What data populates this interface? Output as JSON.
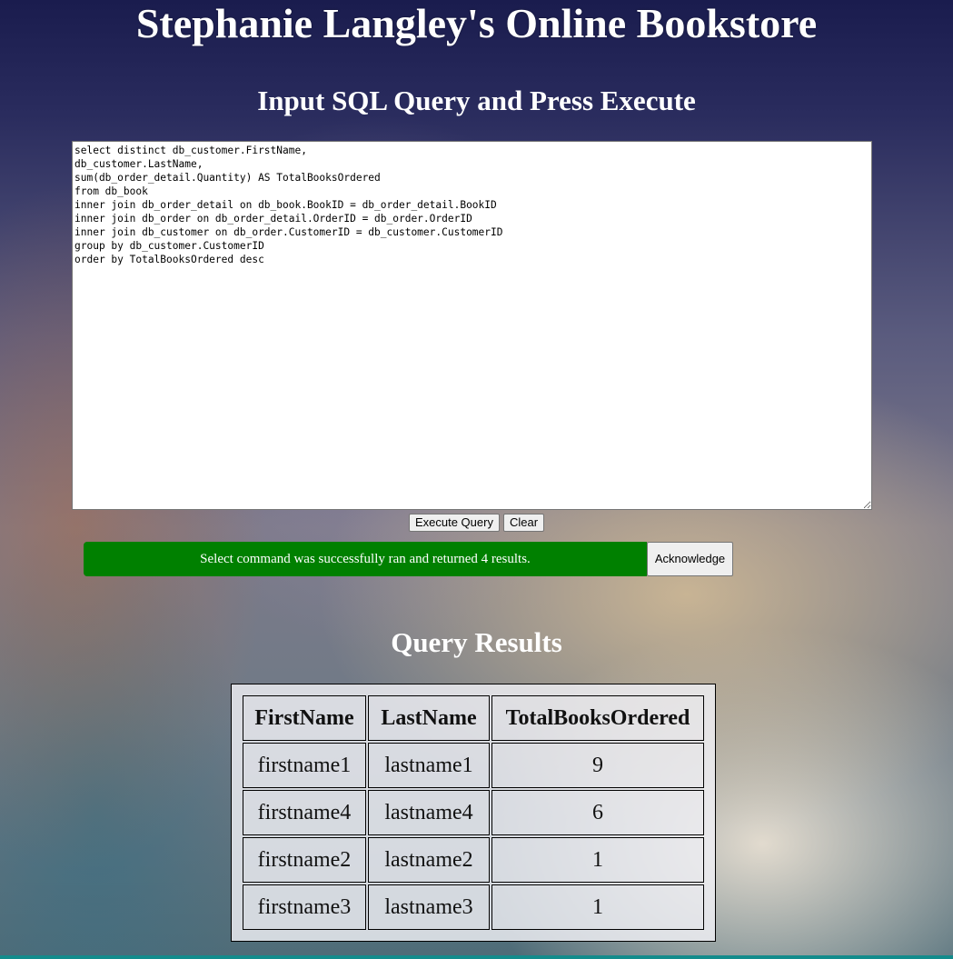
{
  "header": {
    "title": "Stephanie Langley's Online Bookstore",
    "query_heading": "Input SQL Query and Press Execute"
  },
  "query": {
    "text": "select distinct db_customer.FirstName,\ndb_customer.LastName,\nsum(db_order_detail.Quantity) AS TotalBooksOrdered\nfrom db_book\ninner join db_order_detail on db_book.BookID = db_order_detail.BookID\ninner join db_order on db_order_detail.OrderID = db_order.OrderID\ninner join db_customer on db_order.CustomerID = db_customer.CustomerID\ngroup by db_customer.CustomerID\norder by TotalBooksOrdered desc"
  },
  "buttons": {
    "execute_label": "Execute Query",
    "clear_label": "Clear",
    "acknowledge_label": "Acknowledge"
  },
  "status": {
    "message": "Select command was successfully ran and returned 4 results.",
    "color": "#008000"
  },
  "results": {
    "heading": "Query Results",
    "columns": [
      "FirstName",
      "LastName",
      "TotalBooksOrdered"
    ],
    "rows": [
      [
        "firstname1",
        "lastname1",
        "9"
      ],
      [
        "firstname4",
        "lastname4",
        "6"
      ],
      [
        "firstname2",
        "lastname2",
        "1"
      ],
      [
        "firstname3",
        "lastname3",
        "1"
      ]
    ]
  }
}
